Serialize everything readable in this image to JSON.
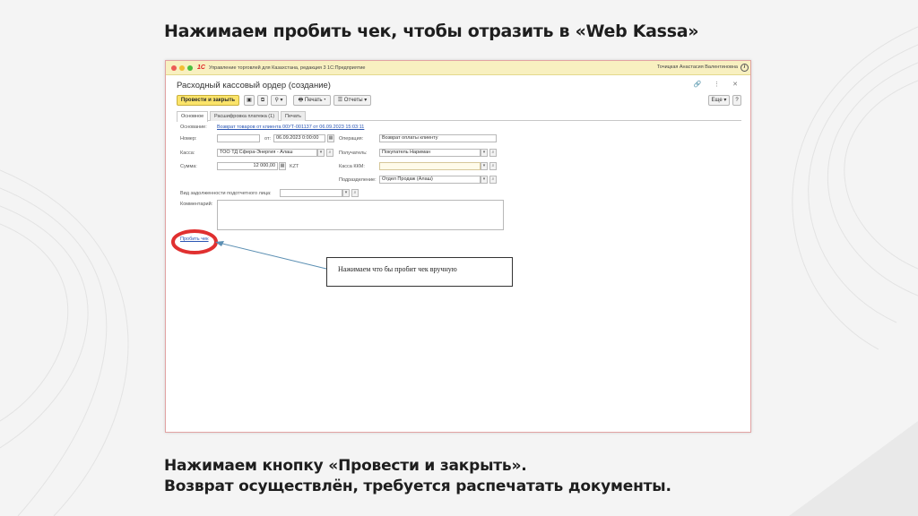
{
  "slide": {
    "title": "Нажимаем пробить чек, чтобы отразить в «Web Kassa»",
    "caption_line1": "Нажимаем кнопку «Провести и закрыть».",
    "caption_line2": "Возврат осуществлён, требуется распечатать документы.",
    "callout_text": "Нажимаем что бы пробит чек вручную",
    "highlight_color": "#e03030"
  },
  "window": {
    "logo": "1С",
    "app_title": "Управление торговлей для Казахстана, редакция 3 1С:Предприятие",
    "user": "Точицкая Анастасия Валентиновна",
    "info_icon": "i",
    "doc_title": "Расходный кассовый ордер (создание)",
    "header_icons": "🔗 ⋮ ✕"
  },
  "toolbar": {
    "post_close": "Провести и закрыть",
    "save_icon": "▣",
    "copy_icon": "⧉",
    "attach_icon": "⚲ ▾",
    "print": "🖶 Печать ▾",
    "reports": "☰ Отчеты ▾",
    "more": "Еще ▾",
    "help": "?"
  },
  "tabs": [
    "Основное",
    "Расшифровка платежа (1)",
    "Печать"
  ],
  "form": {
    "basis_label": "Основание:",
    "basis_link": "Возврат товаров от клиента 00УТ-001137 от 06.09.2023 15:03:11",
    "number_label": "Номер:",
    "number_value": "",
    "from_label": "от:",
    "date_value": "06.09.2023  0:00:00",
    "operation_label": "Операция:",
    "operation_value": "Возврат оплаты клиенту",
    "kassa_label": "Касса:",
    "kassa_value": "ТОО ТД Сфера-Энергия - Алаш",
    "recipient_label": "Получатель:",
    "recipient_value": "Покупатель Нариман",
    "sum_label": "Сумма:",
    "sum_value": "12 000,00",
    "currency": "KZT",
    "kkm_label": "Касса ККМ:",
    "kkm_value": "",
    "division_label": "Подразделение:",
    "division_value": "Отдел Продаж (Алаш)",
    "debt_label": "Вид задолженности подотчетного лица:",
    "debt_value": "",
    "comment_label": "Комментарий:",
    "punch_link": "Пробить чек"
  }
}
